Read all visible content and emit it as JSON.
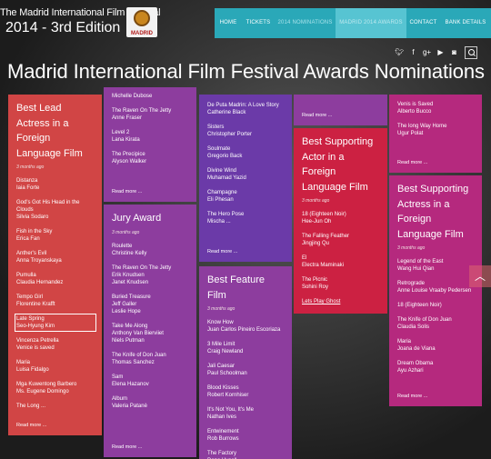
{
  "site": {
    "title_line1": "The Madrid International Film Festival",
    "title_line2": "2014 - 3rd Edition",
    "logo_text": "MADRID"
  },
  "nav": [
    "HOME",
    "TICKETS",
    "2014 NOMINATIONS",
    "MADRID 2014 AWARDS",
    "CONTACT",
    "BANK DETAILS"
  ],
  "social_icons": [
    "twitter-icon",
    "facebook-icon",
    "google-plus-icon",
    "youtube-icon",
    "instagram-icon"
  ],
  "page_title": "Madrid International Film Festival Awards Nominations",
  "read_more": "Read more ...",
  "cards": {
    "lead_actress": {
      "title": "Best Lead Actress in a Foreign Language Film",
      "ago": "3 months ago",
      "entries": [
        [
          "Distanza",
          "Iaia Forte"
        ],
        [
          "God's Got His Head in the Clouds",
          "Silvia Sodaro"
        ],
        [
          "Fish in the Sky",
          "Erica Fan"
        ],
        [
          "Anther's Evil",
          "Anna Troyanskaya"
        ],
        [
          "Pumulla",
          "Claudia Hernandez"
        ],
        [
          "Tempo Girl",
          "Florentine Krafft"
        ],
        [
          "Late Spring",
          "Seo-Hyung Kim"
        ],
        [
          "Vincenza Petrella",
          "Venice is saved"
        ],
        [
          "Maria",
          "Luisa Fidalgo"
        ],
        [
          "Mga Kuwentong Barbero",
          "Ms. Eugene Domingo"
        ],
        [
          "The Long ...",
          ""
        ]
      ]
    },
    "col2_top": {
      "entries": [
        [
          "Michelle Dubose",
          ""
        ],
        [
          "The Raven On The Jetty",
          "Anne Fraser"
        ],
        [
          "Level 2",
          "Lana Kirata"
        ],
        [
          "The Precipice",
          "Alyson Walker"
        ]
      ]
    },
    "jury": {
      "title": "Jury Award",
      "ago": "3 months ago",
      "entries": [
        [
          "Roulette",
          "Christine Kelly"
        ],
        [
          "The Raven On The Jetty",
          "Erik Knudsen",
          "Janet Knudsen"
        ],
        [
          "Buried Treasure",
          "Jeff Galler",
          "Leslie Hope"
        ],
        [
          "Take Me Along",
          "Anthony Van Bierviiet",
          "Niels Putman"
        ],
        [
          "The Knife of Don Juan",
          "Thomas Sanchez"
        ],
        [
          "Sam",
          "Elena Hazanov"
        ],
        [
          "Album",
          "Valeria Patanè"
        ]
      ]
    },
    "col3_top": {
      "entries": [
        [
          "De Puta Madrin: A Love Story",
          "Catherine Black"
        ],
        [
          "Sisters",
          "Christopher Porter"
        ],
        [
          "Soulmate",
          "Gregorio Back"
        ],
        [
          "Divine Wind",
          "Muhamad Yazid"
        ],
        [
          "Champagne",
          "Eli Phesan"
        ],
        [
          "The Hero Pose",
          "Mischa ..."
        ]
      ]
    },
    "feature": {
      "title": "Best Feature Film",
      "ago": "3 months ago",
      "entries": [
        [
          "Know How",
          "Juan Carlos Pineiro Escoriaza"
        ],
        [
          "3 Mile Limit",
          "Craig Newland"
        ],
        [
          "Jali Caesar",
          "Paul Schoolman"
        ],
        [
          "Blood Kisses",
          "Robert Kornhiser"
        ],
        [
          "It's Not You, It's Me",
          "Nathan Ives"
        ],
        [
          "Entwinement",
          "Rob Burrows"
        ],
        [
          "The Factory",
          "Dana Hysell"
        ]
      ]
    },
    "supporting_actor": {
      "title": "Best Supporting Actor in a Foreign Language Film",
      "ago": "3 months ago",
      "entries": [
        [
          "18 (Eighteen Noir)",
          "Hee-Jun Oh"
        ],
        [
          "The Falling Feather",
          "Jingjing Qu"
        ],
        [
          "El",
          "Electra Maminaki"
        ],
        [
          "The Picnic",
          "Sohini Roy"
        ],
        [
          "Lets Play Ghost",
          ""
        ]
      ]
    },
    "col5_top": {
      "entries": [
        [
          "Venis is Saved",
          "Alberto Bucco"
        ],
        [
          "The long Way Home",
          "Ugur Polat"
        ]
      ]
    },
    "supporting_actress": {
      "title": "Best Supporting Actress in a Foreign Language Film",
      "ago": "3 months ago",
      "entries": [
        [
          "Legend of the East",
          "Wang Hui Qian"
        ],
        [
          "Retrograde",
          "Anne Louise Vraaby Pedersen"
        ],
        [
          "18 (Eighteen Noir)",
          ""
        ],
        [
          "The Knife of Don Juan",
          "Claudia Solis"
        ],
        [
          "Maria",
          "Joana de Viana"
        ],
        [
          "Dream Obama",
          "Ayu Azhari"
        ]
      ]
    }
  }
}
